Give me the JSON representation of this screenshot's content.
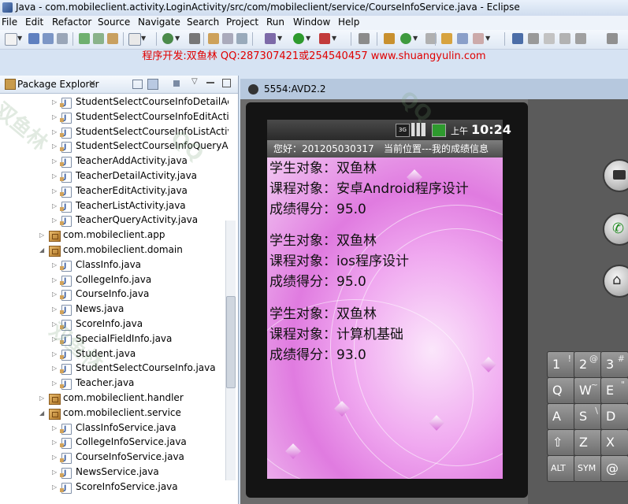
{
  "window": {
    "title": "Java - com.mobileclient.activity.LoginActivity/src/com/mobileclient/service/CourseInfoService.java - Eclipse"
  },
  "menu": [
    "File",
    "Edit",
    "Refactor",
    "Source",
    "Navigate",
    "Search",
    "Project",
    "Run",
    "Window",
    "Help"
  ],
  "banner": "程序开发:双鱼林 QQ:287307421或254540457 www.shuangyulin.com",
  "package_explorer": {
    "title": "Package Explorer",
    "rows": [
      {
        "label": "StudentSelectCourseInfoDetailActiv",
        "kind": "file"
      },
      {
        "label": "StudentSelectCourseInfoEditActivit",
        "kind": "file"
      },
      {
        "label": "StudentSelectCourseInfoListActivity",
        "kind": "file"
      },
      {
        "label": "StudentSelectCourseInfoQueryActi",
        "kind": "file"
      },
      {
        "label": "TeacherAddActivity.java",
        "kind": "file"
      },
      {
        "label": "TeacherDetailActivity.java",
        "kind": "file"
      },
      {
        "label": "TeacherEditActivity.java",
        "kind": "file"
      },
      {
        "label": "TeacherListActivity.java",
        "kind": "file"
      },
      {
        "label": "TeacherQueryActivity.java",
        "kind": "file"
      },
      {
        "label": "com.mobileclient.app",
        "kind": "package"
      },
      {
        "label": "com.mobileclient.domain",
        "kind": "package-open"
      },
      {
        "label": "ClassInfo.java",
        "kind": "file"
      },
      {
        "label": "CollegeInfo.java",
        "kind": "file"
      },
      {
        "label": "CourseInfo.java",
        "kind": "file"
      },
      {
        "label": "News.java",
        "kind": "file"
      },
      {
        "label": "ScoreInfo.java",
        "kind": "file"
      },
      {
        "label": "SpecialFieldInfo.java",
        "kind": "file"
      },
      {
        "label": "Student.java",
        "kind": "file"
      },
      {
        "label": "StudentSelectCourseInfo.java",
        "kind": "file"
      },
      {
        "label": "Teacher.java",
        "kind": "file"
      },
      {
        "label": "com.mobileclient.handler",
        "kind": "package"
      },
      {
        "label": "com.mobileclient.service",
        "kind": "package-open"
      },
      {
        "label": "ClassInfoService.java",
        "kind": "file"
      },
      {
        "label": "CollegeInfoService.java",
        "kind": "file"
      },
      {
        "label": "CourseInfoService.java",
        "kind": "file"
      },
      {
        "label": "NewsService.java",
        "kind": "file"
      },
      {
        "label": "ScoreInfoService.java",
        "kind": "file"
      }
    ]
  },
  "emulator": {
    "title": "5554:AVD2.2",
    "status_time": "10:24",
    "status_ampm": "上午",
    "header_greeting": "您好：201205030317",
    "header_location": "当前位置---我的成绩信息",
    "records": [
      {
        "student": "学生对象：双鱼林",
        "course": "课程对象：安卓Android程序设计",
        "score": "成绩得分：95.0"
      },
      {
        "student": "学生对象：双鱼林",
        "course": "课程对象：ios程序设计",
        "score": "成绩得分：95.0"
      },
      {
        "student": "学生对象：双鱼林",
        "course": "课程对象：计算机基础",
        "score": "成绩得分：93.0"
      }
    ],
    "keys": {
      "row1": [
        {
          "main": "1",
          "sub": "!"
        },
        {
          "main": "2",
          "sub": "@"
        },
        {
          "main": "3",
          "sub": "#"
        }
      ],
      "row2": [
        {
          "main": "Q",
          "sub": ""
        },
        {
          "main": "W",
          "sub": "~"
        },
        {
          "main": "E",
          "sub": "\""
        }
      ],
      "row3": [
        {
          "main": "A",
          "sub": ""
        },
        {
          "main": "S",
          "sub": "\\"
        },
        {
          "main": "D",
          "sub": ""
        }
      ],
      "row4": [
        {
          "main": "⇧",
          "sub": ""
        },
        {
          "main": "Z",
          "sub": ""
        },
        {
          "main": "X",
          "sub": ""
        }
      ],
      "row5": [
        {
          "main": "ALT",
          "sub": ""
        },
        {
          "main": "SYM",
          "sub": ""
        },
        {
          "main": "@",
          "sub": ""
        }
      ]
    }
  },
  "colors": {
    "banner": "#e00000",
    "accent": "#3a5ea0"
  }
}
